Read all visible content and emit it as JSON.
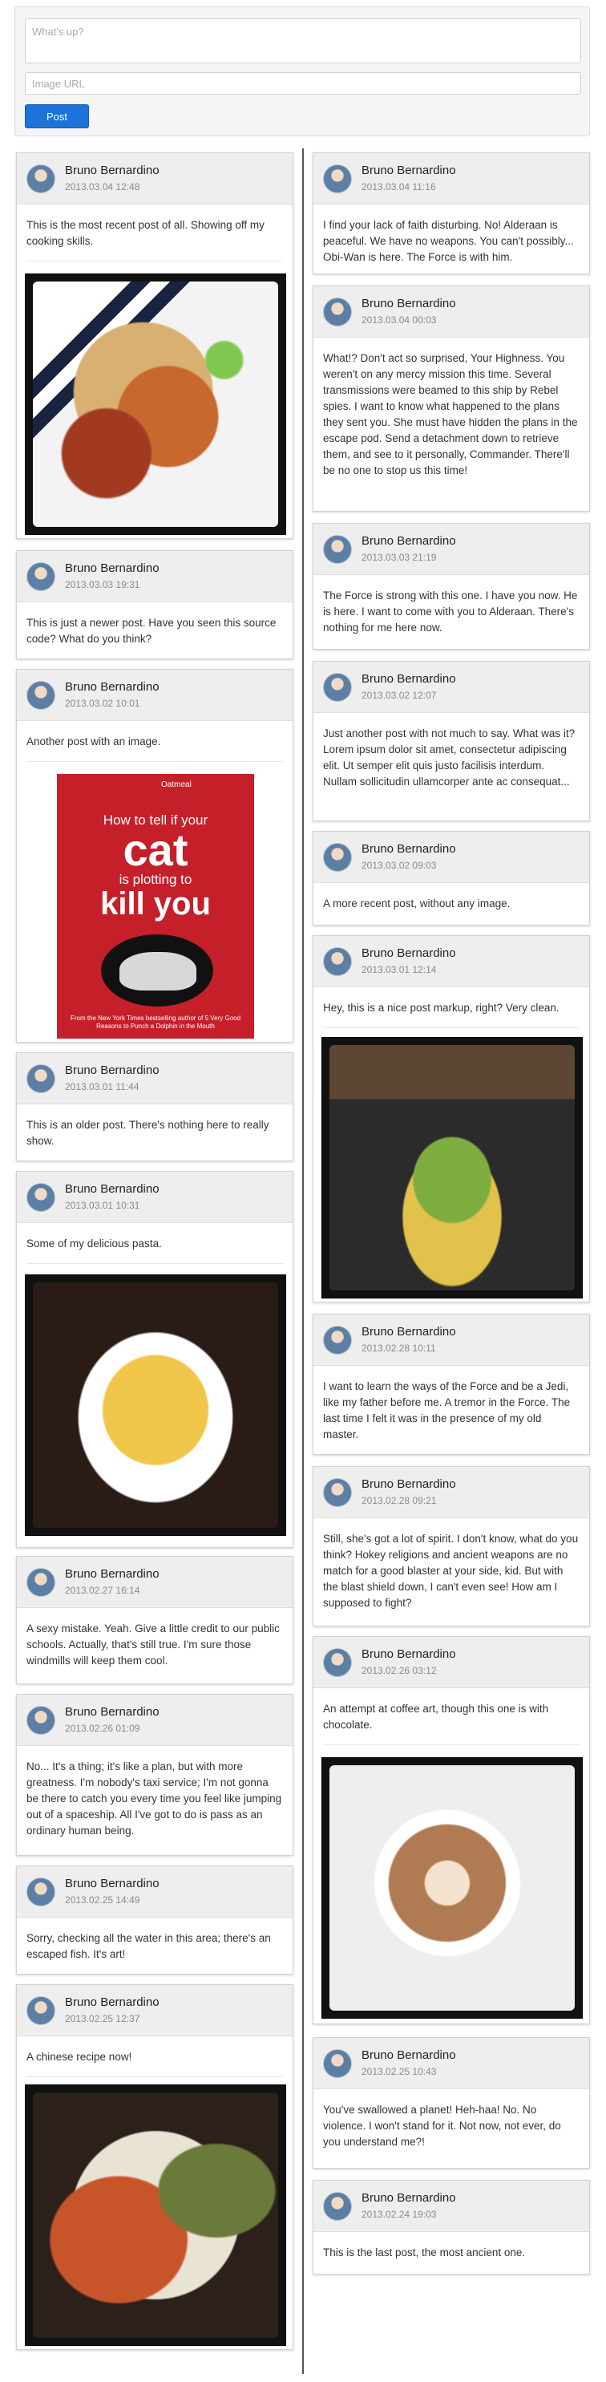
{
  "composer": {
    "status_placeholder": "What's up?",
    "image_placeholder": "Image URL",
    "post_label": "Post"
  },
  "author": "Bruno Bernardino",
  "posts": [
    {
      "date": "2013.03.04 12:48",
      "text": "This is the most recent post of all. Showing off my cooking skills.",
      "image": "food-photo"
    },
    {
      "date": "2013.03.04 11:16",
      "text": "I find your lack of faith disturbing. No! Alderaan is peaceful. We have no weapons. You can't possibly... Obi-Wan is here. The Force is with him."
    },
    {
      "date": "2013.03.04 00:03",
      "text": "What!? Don't act so surprised, Your Highness. You weren't on any mercy mission this time. Several transmissions were beamed to this ship by Rebel spies. I want to know what happened to the plans they sent you. She must have hidden the plans in the escape pod. Send a detachment down to retrieve them, and see to it personally, Commander. There'll be no one to stop us this time!"
    },
    {
      "date": "2013.03.03 19:31",
      "text": "This is just a newer post. Have you seen this source code? What do you think?"
    },
    {
      "date": "2013.03.03 21:19",
      "text": "The Force is strong with this one. I have you now. He is here. I want to come with you to Alderaan. There's nothing for me here now."
    },
    {
      "date": "2013.03.02 10:01",
      "text": "Another post with an image.",
      "image": "book-photo",
      "book": {
        "brand": "Oatmeal",
        "line1": "How to tell if your",
        "line2": "cat",
        "line3": "is plotting to",
        "line4": "kill you",
        "footer": "From the New York Times bestselling author of 5 Very Good Reasons to Punch a Dolphin in the Mouth"
      }
    },
    {
      "date": "2013.03.02 12:07",
      "text": "Just another post with not much to say. What was it? Lorem ipsum dolor sit amet, consectetur adipiscing elit. Ut semper elit quis justo facilisis interdum. Nullam sollicitudin ullamcorper ante ac consequat..."
    },
    {
      "date": "2013.03.02 09:03",
      "text": "A more recent post, without any image."
    },
    {
      "date": "2013.03.01 12:14",
      "text": "Hey, this is a nice post markup, right? Very clean.",
      "image": "mojito-photo"
    },
    {
      "date": "2013.03.01 11:44",
      "text": "This is an older post. There's nothing here to really show."
    },
    {
      "date": "2013.03.01 10:31",
      "text": "Some of my delicious pasta.",
      "image": "pasta-photo"
    },
    {
      "date": "2013.02.28 10:11",
      "text": "I want to learn the ways of the Force and be a Jedi, like my father before me. A tremor in the Force. The last time I felt it was in the presence of my old master."
    },
    {
      "date": "2013.02.28 09:21",
      "text": "Still, she's got a lot of spirit. I don't know, what do you think? Hokey religions and ancient weapons are no match for a good blaster at your side, kid. But with the blast shield down, I can't even see! How am I supposed to fight?"
    },
    {
      "date": "2013.02.27 16:14",
      "text": "A sexy mistake. Yeah. Give a little credit to our public schools. Actually, that's still true. I'm sure those windmills will keep them cool."
    },
    {
      "date": "2013.02.26 03:12",
      "text": "An attempt at coffee art, though this one is with chocolate.",
      "image": "coffee-photo"
    },
    {
      "date": "2013.02.26 01:09",
      "text": "No... It's a thing; it's like a plan, but with more greatness. I'm nobody's taxi service; I'm not gonna be there to catch you every time you feel like jumping out of a spaceship. All I've got to do is pass as an ordinary human being."
    },
    {
      "date": "2013.02.25 14:49",
      "text": "Sorry, checking all the water in this area; there's an escaped fish. It's art!"
    },
    {
      "date": "2013.02.25 12:37",
      "text": "A chinese recipe now!",
      "image": "chinese-food-photo"
    },
    {
      "date": "2013.02.25 10:43",
      "text": "You've swallowed a planet! Heh-haa! No. No violence. I won't stand for it. Not now, not ever, do you understand me?!"
    },
    {
      "date": "2013.02.24 19:03",
      "text": "This is the last post, the most ancient one."
    }
  ]
}
